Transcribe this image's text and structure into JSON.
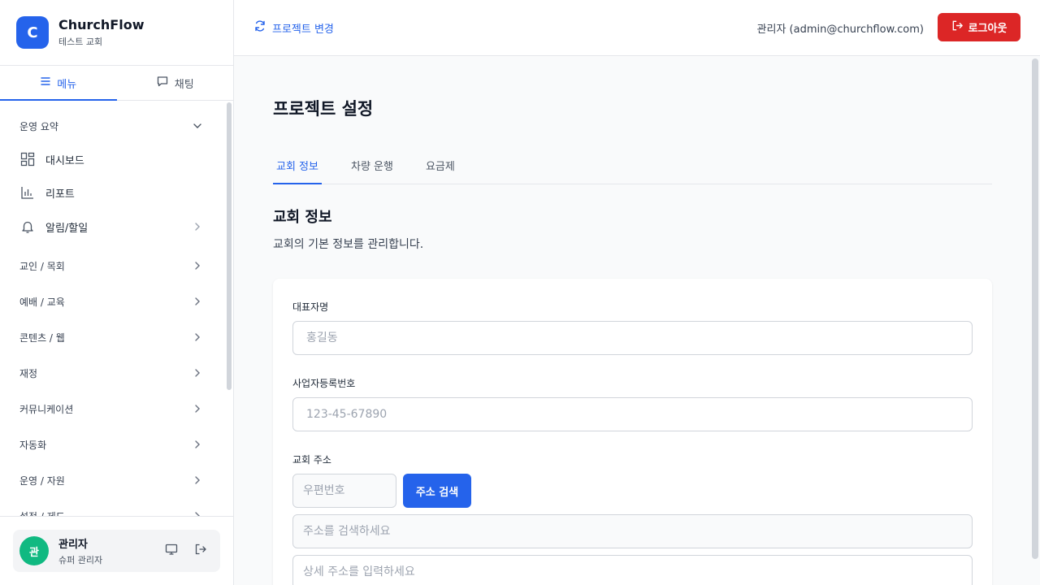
{
  "brand": {
    "logo_letter": "C",
    "name": "ChurchFlow",
    "church": "테스트 교회"
  },
  "sidebar_tabs": [
    {
      "label": "메뉴",
      "icon": "menu-icon",
      "active": true
    },
    {
      "label": "채팅",
      "icon": "chat-icon",
      "active": false
    }
  ],
  "menu": {
    "summary_group": "운영 요약",
    "items": [
      {
        "label": "대시보드",
        "icon": "dashboard-icon"
      },
      {
        "label": "리포트",
        "icon": "bar-chart-icon"
      },
      {
        "label": "알림/할일",
        "icon": "bell-icon"
      }
    ],
    "groups": [
      "교인 / 목회",
      "예배 / 교육",
      "콘텐츠 / 웹",
      "재정",
      "커뮤니케이션",
      "자동화",
      "운영 / 자원",
      "설정 / 제도"
    ]
  },
  "user": {
    "avatar_initial": "관",
    "name": "관리자",
    "role": "슈퍼 관리자"
  },
  "header": {
    "project_switch": "프로젝트 변경",
    "admin_label": "관리자 (admin@churchflow.com)",
    "logout": "로그아웃"
  },
  "page": {
    "title": "프로젝트 설정",
    "tabs": [
      {
        "label": "교회 정보",
        "active": true
      },
      {
        "label": "차량 운행",
        "active": false
      },
      {
        "label": "요금제",
        "active": false
      }
    ],
    "section_title": "교회 정보",
    "section_desc": "교회의 기본 정보를 관리합니다."
  },
  "form": {
    "representative": {
      "label": "대표자명",
      "placeholder": "홍길동",
      "value": ""
    },
    "business_number": {
      "label": "사업자등록번호",
      "placeholder": "123-45-67890",
      "value": ""
    },
    "address": {
      "label": "교회 주소",
      "zip_placeholder": "우편번호",
      "search_button": "주소 검색",
      "address_placeholder": "주소를 검색하세요",
      "detail_placeholder": "상세 주소를 입력하세요"
    }
  },
  "colors": {
    "primary": "#2563eb",
    "danger": "#dc2626",
    "avatar": "#10b981"
  }
}
